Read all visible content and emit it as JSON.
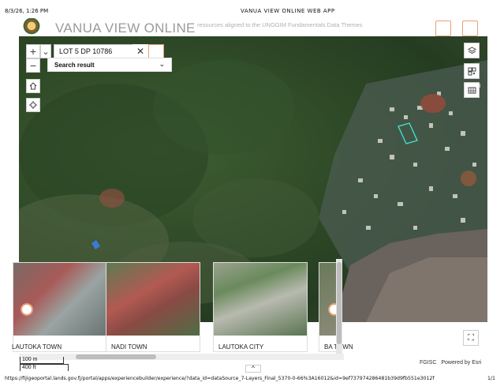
{
  "print": {
    "date": "8/3/26, 1:26 PM",
    "page_title": "VANUA VIEW ONLINE WEB APP",
    "url": "https://fijigeoportal.lands.gov.fj/portal/apps/experiencebuilder/experience/?data_id=dataSource_7-Layers_Final_5370-0-66%3A16012&id=9ef737974286481b39d9fb551e3012f",
    "page_number": "1/1"
  },
  "header": {
    "app_title": "VANUA VIEW ONLINE",
    "tagline": "resources aligned to the UNGGIM Fundamentals Data Themes",
    "logo_icon": "fiji-coat-of-arms-icon",
    "accent_color": "#e8a076"
  },
  "search": {
    "value": "LOT 5 DP 10786",
    "clear_icon": "close-icon",
    "dropdown_label": "Search result",
    "dropdown_icon": "chevron-down-icon"
  },
  "map_controls": {
    "zoom_in": "+",
    "zoom_out": "−",
    "expand_chevron": "⌄",
    "home_icon": "home-icon",
    "locate_icon": "locate-icon",
    "layers_icon": "layers-icon",
    "qr_icon": "qr-code-icon",
    "basemap_icon": "basemap-gallery-icon",
    "fullscreen_icon": "fullscreen-icon",
    "fullscreen_glyph": "⛶"
  },
  "bookmarks": [
    {
      "label": "LAUTOKA TOWN"
    },
    {
      "label": "NADI TOWN"
    },
    {
      "label": "LAUTOKA CITY"
    },
    {
      "label": "BA TOWN"
    }
  ],
  "scale": {
    "metric": "100 m",
    "imperial": "400 ft"
  },
  "attribution": {
    "source": "FGISC",
    "powered_by": "Powered by Esri"
  },
  "expand_panel": "^"
}
